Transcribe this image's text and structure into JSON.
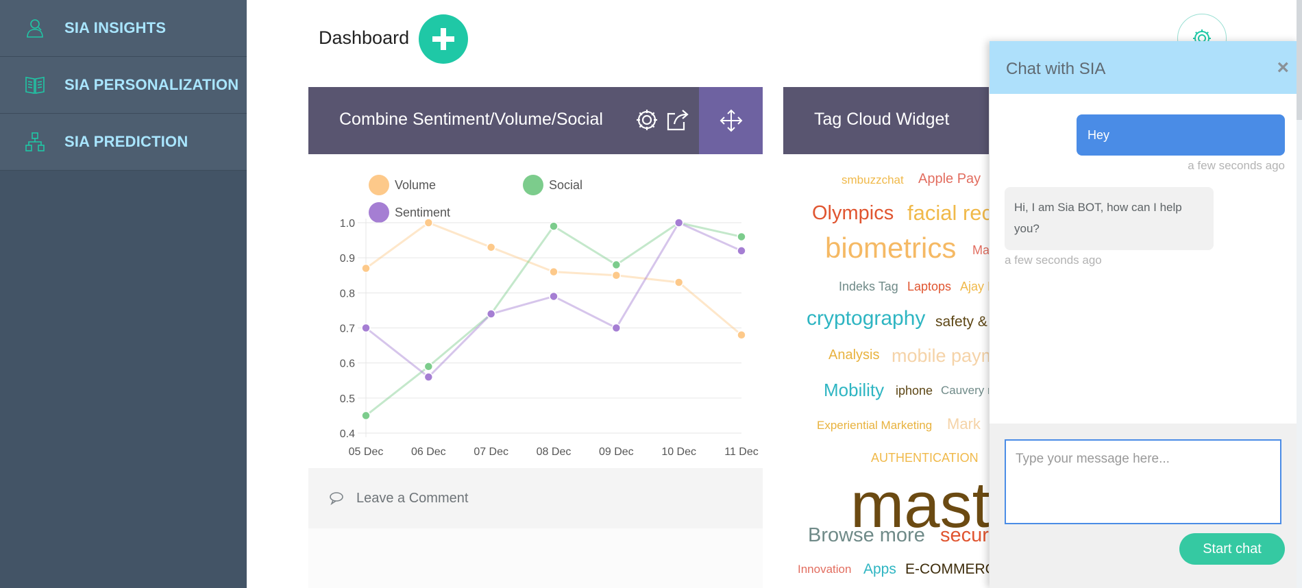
{
  "sidebar": {
    "items": [
      {
        "label": "SIA INSIGHTS",
        "icon": "user-icon"
      },
      {
        "label": "SIA PERSONALIZATION",
        "icon": "book-icon"
      },
      {
        "label": "SIA PREDICTION",
        "icon": "network-icon"
      }
    ]
  },
  "header": {
    "title": "Dashboard",
    "add_icon": "plus-icon",
    "settings_icon": "gear-icon"
  },
  "widget1": {
    "title": "Combine Sentiment/Volume/Social",
    "icons": [
      "gear-icon",
      "share-icon",
      "move-icon"
    ],
    "comment_label": "Leave a Comment"
  },
  "widget2": {
    "title": "Tag Cloud Widget",
    "tags": [
      {
        "text": "smbuzzchat",
        "color": "#f0b94a"
      },
      {
        "text": "Apple Pay",
        "color": "#e26d5f"
      },
      {
        "text": "Olympics",
        "color": "#e05530"
      },
      {
        "text": "facial rec",
        "color": "#f0b94a"
      },
      {
        "text": "biometrics",
        "color": "#f5b964"
      },
      {
        "text": "Ma",
        "color": "#e26d5f"
      },
      {
        "text": "Indeks Tag",
        "color": "#6f8a88"
      },
      {
        "text": "Laptops",
        "color": "#e05530"
      },
      {
        "text": "Ajay B",
        "color": "#f0b94a"
      },
      {
        "text": "cryptography",
        "color": "#2eb5c2"
      },
      {
        "text": "safety &",
        "color": "#5d4615"
      },
      {
        "text": "Analysis",
        "color": "#e8b23e"
      },
      {
        "text": "mobile paym",
        "color": "#f5d3a8"
      },
      {
        "text": "Mobility",
        "color": "#2eb5c2"
      },
      {
        "text": "iphone",
        "color": "#5d4615"
      },
      {
        "text": "Cauvery n",
        "color": "#6f8a88"
      },
      {
        "text": "Experiential Marketing",
        "color": "#e8b23e"
      },
      {
        "text": "Mark",
        "color": "#f5d3a8"
      },
      {
        "text": "AUTHENTICATION",
        "color": "#f0b94a"
      },
      {
        "text": "mast",
        "color": "#6b4a12"
      },
      {
        "text": "Browse more",
        "color": "#6f8a88"
      },
      {
        "text": "secur",
        "color": "#e05530"
      },
      {
        "text": "Innovation",
        "color": "#e26d5f"
      },
      {
        "text": "Apps",
        "color": "#2eb5c2"
      },
      {
        "text": "E-COMMERC",
        "color": "#3d2c0b"
      }
    ]
  },
  "chat": {
    "title": "Chat with SIA",
    "close_icon": "close-icon",
    "messages": [
      {
        "from": "user",
        "text": "Hey",
        "time": "a few seconds ago"
      },
      {
        "from": "bot",
        "text": "Hi, I am Sia BOT, how can I help you?",
        "time": "a few seconds ago"
      }
    ],
    "input_placeholder": "Type your message here...",
    "start_label": "Start chat"
  },
  "chart_data": {
    "type": "line",
    "categories": [
      "05 Dec",
      "06 Dec",
      "07 Dec",
      "08 Dec",
      "09 Dec",
      "10 Dec",
      "11 Dec"
    ],
    "series": [
      {
        "name": "Volume",
        "color": "#fdc98a",
        "values": [
          0.87,
          1.0,
          0.93,
          0.86,
          0.85,
          0.83,
          0.68
        ]
      },
      {
        "name": "Social",
        "color": "#7ccc8c",
        "values": [
          0.45,
          0.59,
          0.74,
          0.99,
          0.88,
          1.0,
          0.96
        ]
      },
      {
        "name": "Sentiment",
        "color": "#a57ed3",
        "values": [
          0.7,
          0.56,
          0.74,
          0.79,
          0.7,
          1.0,
          0.92
        ]
      }
    ],
    "yticks": [
      "0.4",
      "0.5",
      "0.6",
      "0.7",
      "0.8",
      "0.9",
      "1.0"
    ],
    "ylim": [
      0.4,
      1.0
    ],
    "grid": true,
    "legend_position": "top-left"
  }
}
